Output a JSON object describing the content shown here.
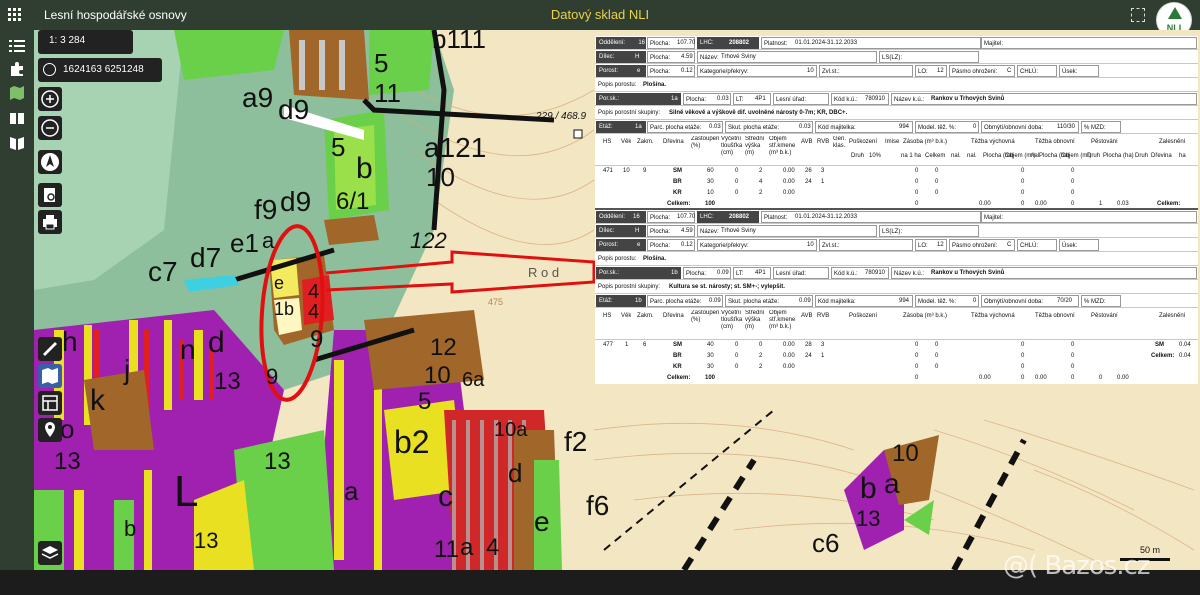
{
  "app": {
    "title": "Lesní hospodářské osnovy",
    "center_title": "Datový sklad NLI",
    "logo_text": "NLI"
  },
  "map": {
    "scale": "1: 3 284",
    "coordinates": "1624163 6251248",
    "scale_bar": "50 m",
    "elevation_label": "229 / 468.9",
    "contour_label": "475",
    "road_label": "R o d",
    "labels": [
      "b111",
      "5",
      "11",
      "a9",
      "d9",
      "a121",
      "10",
      "5",
      "b",
      "6/1",
      "f9",
      "d9",
      "e1",
      "a",
      "c7",
      "d7",
      "122",
      "e",
      "1b",
      "4",
      "4",
      "h",
      "n",
      "d",
      "j",
      "k",
      "13",
      "9",
      "12",
      "10",
      "6a",
      "5",
      "b2",
      "10a",
      "f2",
      "c",
      "d",
      "e",
      "f6",
      "a",
      "13",
      "L",
      "b",
      "13",
      "b",
      "a",
      "10",
      "c6",
      "13",
      "o",
      "13",
      "11",
      "a",
      "4",
      "9"
    ]
  },
  "panel1": {
    "oddeleni_label": "Oddělení:",
    "oddeleni": "16",
    "plocha_label": "Plocha:",
    "plocha": "107.70",
    "lhc_label": "LHC:",
    "lhc": "208802",
    "platnost_label": "Platnost:",
    "platnost": "01.01.2024-31.12.2033",
    "majitel_label": "Majitel:",
    "dilec_label": "Dílec:",
    "dilec": "H",
    "dilec_plocha": "4.59",
    "nazev_label": "Název:",
    "nazev": "Trhové Sviny",
    "ls_label": "LS(LZ):",
    "porost_label": "Porost:",
    "porost": "e",
    "porost_plocha": "0.12",
    "kategorie_label": "Kategorie/překryv:",
    "kategorie": "10",
    "zvl_label": "Zvl.st.:",
    "lo_label": "LO:",
    "lo": "12",
    "pasmo_label": "Pásmo ohrožení:",
    "pasmo": "C",
    "chu_label": "CHLÚ:",
    "usek_label": "Úsek:",
    "popis_porostu_label": "Popis porostu:",
    "popis_porostu": "Plošina.",
    "porsk_label": "Por.sk.:",
    "porsk": "1a",
    "porsk_plocha": "0.03",
    "lt_label": "LT:",
    "lt": "4P1",
    "lesni_urad_label": "Lesní úřad:",
    "kod_ku_label": "Kód k.ú.:",
    "kod_ku": "780910",
    "nazev_ku_label": "Název k.ú.:",
    "nazev_ku": "Rankov u Trhových Svinů",
    "popis_skupiny_label": "Popis porostní skupiny:",
    "popis_skupiny": "Silně věkově a výškově dif. uvolněné nárosty 0-7m; KR, DBC+.",
    "etaz_label": "Etáž:",
    "etaz": "1a",
    "parc_plocha_label": "Parc. plocha etáže:",
    "parc_plocha": "0.03",
    "skut_plocha_label": "Skut. plocha etáže:",
    "skut_plocha": "0.03",
    "kod_majitelka_label": "Kód majitelka:",
    "kod_majitelka": "994",
    "model_label": "Model. těž. %:",
    "model": "0",
    "obmyti_label": "Obmýtí/obnovní doba:",
    "obmyti": "110/30",
    "mzd_label": "% MZD:",
    "headers": [
      "HS",
      "Věk",
      "Zakm.",
      "Dřevina",
      "Zastoupení (%)",
      "Výčetní tloušťka (cm)",
      "Střední výška (m)",
      "Objem stř.kmene (m³ b.k.)",
      "AVB",
      "RVB",
      "Gen. klas.",
      "Poškození",
      "Imise",
      "Zásoba (m³ b.k.)",
      "Těžba výchovná",
      "Těžba obnovní",
      "Pěstování",
      "Zalesnění"
    ],
    "subheaders": [
      "Druh",
      "10%",
      "na 1 ha",
      "Celkem",
      "nal.",
      "nal.",
      "Plocha (ha)",
      "Objem (m³)",
      "nal.",
      "Plocha (ha)",
      "Objem (m³)",
      "Druh",
      "Plocha (ha)",
      "Druh",
      "Dřevina",
      "ha"
    ],
    "rows": [
      {
        "hs": "471",
        "vek": "10",
        "zakm": "9",
        "drevina": "SM",
        "zast": "60",
        "tl": "0",
        "vys": "2",
        "obj": "0.00",
        "avb": "26",
        "rvb": "3",
        "zas1": "0",
        "zas2": "0",
        "v1": "0",
        "v2": "0",
        "o1": "0",
        "o2": "0",
        "p1": "0",
        "p2": "0.00"
      },
      {
        "hs": "",
        "vek": "",
        "zakm": "",
        "drevina": "BR",
        "zast": "30",
        "tl": "0",
        "vys": "4",
        "obj": "0.00",
        "avb": "24",
        "rvb": "1",
        "zas1": "0",
        "zas2": "0",
        "v1": "0",
        "v2": "0",
        "o1": "0",
        "o2": "0",
        "p1": "0",
        "p2": "0.00"
      },
      {
        "hs": "",
        "vek": "",
        "zakm": "",
        "drevina": "KR",
        "zast": "10",
        "tl": "0",
        "vys": "2",
        "obj": "0.00",
        "avb": "",
        "rvb": "",
        "zas1": "0",
        "zas2": "0",
        "v1": "0",
        "v2": "0",
        "o1": "0",
        "o2": "0",
        "p1": "0",
        "p2": "0.00"
      }
    ],
    "celkem_label": "Celkem:",
    "celkem_zast": "100",
    "celkem_vals": [
      "0",
      "0.00",
      "0",
      "0.00",
      "0",
      "1",
      "0.03"
    ],
    "zalesneni_celkem_label": "Celkem:"
  },
  "panel2": {
    "oddeleni": "16",
    "plocha": "107.70",
    "lhc": "208802",
    "platnost": "01.01.2024-31.12.2033",
    "dilec": "H",
    "dilec_plocha": "4.59",
    "nazev": "Trhové Sviny",
    "porost": "e",
    "porost_plocha": "0.12",
    "kategorie": "10",
    "lo": "12",
    "pasmo": "C",
    "popis_porostu": "Plošina.",
    "porsk": "1b",
    "porsk_plocha": "0.09",
    "lt": "4P1",
    "kod_ku": "780910",
    "nazev_ku": "Rankov u Trhových Svinů",
    "popis_skupiny": "Kultura se st. nárosty; st. SM+-; vylepšit.",
    "etaz": "1b",
    "parc_plocha": "0.09",
    "skut_plocha": "0.09",
    "kod_majitelka": "994",
    "model": "0",
    "obmyti": "70/20",
    "rows": [
      {
        "hs": "477",
        "vek": "1",
        "zakm": "6",
        "drevina": "SM",
        "zast": "40",
        "tl": "0",
        "vys": "0",
        "obj": "0.00",
        "avb": "28",
        "rvb": "3",
        "zas1": "0",
        "zas2": "0",
        "v1": "0",
        "v2": "0",
        "o1": "0",
        "o2": "0",
        "z_drevina": "SM",
        "z_ha": "0.04"
      },
      {
        "hs": "",
        "vek": "",
        "zakm": "",
        "drevina": "BR",
        "zast": "30",
        "tl": "0",
        "vys": "2",
        "obj": "0.00",
        "avb": "24",
        "rvb": "1",
        "zas1": "0",
        "zas2": "0",
        "v1": "0",
        "v2": "0",
        "o1": "0",
        "o2": "0",
        "z_drevina": "",
        "z_ha": ""
      },
      {
        "hs": "",
        "vek": "",
        "zakm": "",
        "drevina": "KR",
        "zast": "30",
        "tl": "0",
        "vys": "2",
        "obj": "0.00",
        "avb": "",
        "rvb": "",
        "zas1": "0",
        "zas2": "0",
        "v1": "0",
        "v2": "0",
        "o1": "0",
        "o2": "0",
        "z_drevina": "",
        "z_ha": ""
      }
    ],
    "celkem_label": "Celkem:",
    "celkem_zast": "100",
    "celkem_vals": [
      "0",
      "0.00",
      "0",
      "0.00",
      "0",
      "0",
      "0.00"
    ],
    "zalesneni_celkem": "0.04"
  },
  "watermark": "@( Bazos.cz",
  "colors": {
    "topbar": "#2f3e31",
    "accent_title": "#e8d34a",
    "annotation": "#e01010"
  }
}
